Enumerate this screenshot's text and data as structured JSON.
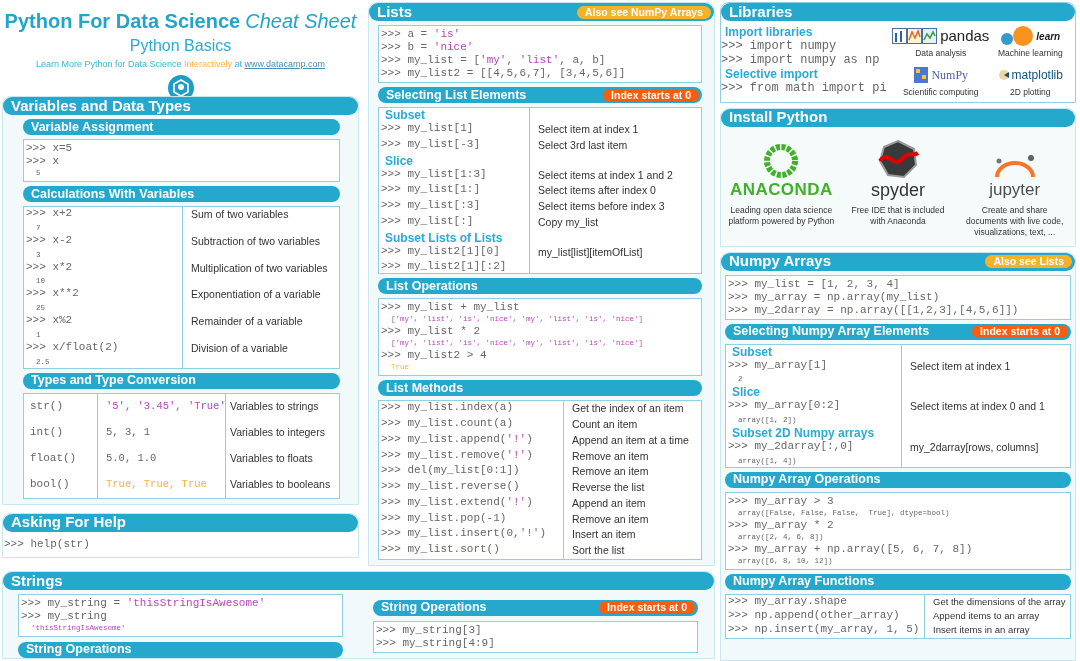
{
  "header": {
    "title": "Python For Data Science",
    "title_italic": "Cheat Sheet",
    "subtitle": "Python Basics",
    "tagline": "Learn More Python for Data Science",
    "tagline_highlight": "Interactively",
    "tagline_after": "at",
    "link": "www.datacamp.com"
  },
  "variables": {
    "title": "Variables and Data Types",
    "assignment": {
      "title": "Variable Assignment",
      "lines": [
        {
          "kind": "code",
          "text": ">>> x=5"
        },
        {
          "kind": "code",
          "text": ">>> x"
        },
        {
          "kind": "output",
          "text": "5"
        }
      ]
    },
    "calculations": {
      "title": "Calculations With Variables",
      "rows": [
        {
          "kind": "code",
          "text": ">>> x+2",
          "note": "Sum of two variables"
        },
        {
          "kind": "output",
          "text": "7"
        },
        {
          "kind": "code",
          "text": ">>> x-2",
          "note": "Subtraction of two variables"
        },
        {
          "kind": "output",
          "text": "3"
        },
        {
          "kind": "code",
          "text": ">>> x*2",
          "note": "Multiplication of two variables"
        },
        {
          "kind": "output",
          "text": "10"
        },
        {
          "kind": "code",
          "text": ">>> x**2",
          "note": "Exponentiation of a variable"
        },
        {
          "kind": "output",
          "text": "25"
        },
        {
          "kind": "code",
          "text": ">>> x%2",
          "note": "Remainder of a variable"
        },
        {
          "kind": "output",
          "text": "1"
        },
        {
          "kind": "code",
          "text": ">>> x/float(2)",
          "note": "Division of a variable"
        },
        {
          "kind": "output",
          "text": "2.5"
        }
      ]
    },
    "types": {
      "title": "Types and Type Conversion",
      "rows": [
        {
          "kind": "string",
          "function": "str()",
          "values": "'5', '3.45', 'True'",
          "note": "Variables to strings"
        },
        {
          "kind": "number",
          "function": "int()",
          "values": "5, 3, 1",
          "note": "Variables to integers"
        },
        {
          "kind": "number",
          "function": "float()",
          "values": "5.0, 1.0",
          "note": "Variables to floats"
        },
        {
          "kind": "boolean",
          "function": "bool()",
          "values": "True, True, True",
          "note": "Variables to booleans"
        }
      ]
    }
  },
  "help": {
    "title": "Asking For Help",
    "lines": [
      {
        "kind": "code",
        "text": ">>> help(str)"
      }
    ]
  },
  "strings": {
    "title": "Strings",
    "intro": {
      "lines": [
        {
          "kind": "code",
          "text": ">>> my_string = 'thisStringIsAwesome'"
        },
        {
          "kind": "code",
          "text": ">>> my_string"
        },
        {
          "kind": "string",
          "text": "'thisStringIsAwesome'"
        }
      ]
    },
    "operations_left": {
      "title": "String Operations"
    },
    "operations": {
      "title": "String Operations",
      "badge": {
        "text": "Index starts at 0",
        "kind": "warning"
      },
      "lines": [
        {
          "kind": "code",
          "text": ">>> my_string[3]"
        },
        {
          "kind": "code",
          "text": ">>> my_string[4:9]"
        }
      ]
    }
  },
  "lists": {
    "title": "Lists",
    "badge": {
      "text": "Also see NumPy Arrays",
      "kind": "note"
    },
    "intro": {
      "lines": [
        {
          "kind": "code",
          "text": ">>> a = 'is'"
        },
        {
          "kind": "code",
          "text": ">>> b = 'nice'"
        },
        {
          "kind": "code",
          "text": ">>> my_list = ['my', 'list', a, b]"
        },
        {
          "kind": "code",
          "text": ">>> my_list2 = [[4,5,6,7], [3,4,5,6]]"
        }
      ]
    },
    "selecting": {
      "title": "Selecting List Elements",
      "badge": {
        "text": "Index starts at 0",
        "kind": "warning"
      },
      "rows": [
        {
          "kind": "label",
          "text": "Subset"
        },
        {
          "kind": "code",
          "text": ">>> my_list[1]",
          "note": "Select item at index 1"
        },
        {
          "kind": "code",
          "text": ">>> my_list[-3]",
          "note": "Select 3rd last item"
        },
        {
          "kind": "label",
          "text": "Slice"
        },
        {
          "kind": "code",
          "text": ">>> my_list[1:3]",
          "note": "Select items at index 1 and 2"
        },
        {
          "kind": "code",
          "text": ">>> my_list[1:]",
          "note": "Select items after index 0"
        },
        {
          "kind": "code",
          "text": ">>> my_list[:3]",
          "note": "Select items before index 3"
        },
        {
          "kind": "code",
          "text": ">>> my_list[:]",
          "note": "Copy my_list"
        },
        {
          "kind": "label",
          "text": "Subset Lists of Lists"
        },
        {
          "kind": "code",
          "text": ">>> my_list2[1][0]",
          "note": "my_list[list][itemOfList]"
        },
        {
          "kind": "code",
          "text": ">>> my_list2[1][:2]"
        }
      ]
    },
    "operations": {
      "title": "List Operations",
      "lines": [
        {
          "kind": "code",
          "text": ">>> my_list + my_list"
        },
        {
          "kind": "string",
          "text": "['my', 'list', 'is', 'nice', 'my', 'list', 'is', 'nice']"
        },
        {
          "kind": "code",
          "text": ">>> my_list * 2"
        },
        {
          "kind": "string",
          "text": "['my', 'list', 'is', 'nice', 'my', 'list', 'is', 'nice']"
        },
        {
          "kind": "code",
          "text": ">>> my_list2 > 4"
        },
        {
          "kind": "boolean",
          "text": "True"
        }
      ]
    },
    "methods": {
      "title": "List Methods",
      "rows": [
        {
          "kind": "code",
          "text": ">>> my_list.index(a)",
          "note": "Get the index of an item"
        },
        {
          "kind": "code",
          "text": ">>> my_list.count(a)",
          "note": "Count an item"
        },
        {
          "kind": "code",
          "text": ">>> my_list.append('!')",
          "note": "Append an item at a time"
        },
        {
          "kind": "code",
          "text": ">>> my_list.remove('!')",
          "note": "Remove an item"
        },
        {
          "kind": "code",
          "text": ">>> del(my_list[0:1])",
          "note": "Remove an item"
        },
        {
          "kind": "code",
          "text": ">>> my_list.reverse()",
          "note": "Reverse the list"
        },
        {
          "kind": "code",
          "text": ">>> my_list.extend('!')",
          "note": "Append an item"
        },
        {
          "kind": "code",
          "text": ">>> my_list.pop(-1)",
          "note": "Remove an item"
        },
        {
          "kind": "code",
          "text": ">>> my_list.insert(0,'!')",
          "note": "Insert an item"
        },
        {
          "kind": "code",
          "text": ">>> my_list.sort()",
          "note": "Sort the list"
        }
      ]
    }
  },
  "libraries": {
    "title": "Libraries",
    "rows": [
      {
        "kind": "label",
        "text": "Import libraries"
      },
      {
        "kind": "code",
        "text": ">>> import numpy"
      },
      {
        "kind": "code",
        "text": ">>> import numpy as np"
      },
      {
        "kind": "label",
        "text": "Selective import"
      },
      {
        "kind": "code",
        "text": ">>> from math import pi"
      }
    ],
    "logos": [
      {
        "kind": "pandas",
        "text": "pandas",
        "caption": "Data analysis"
      },
      {
        "kind": "sklearn",
        "text": "learn",
        "caption": "Machine learning"
      },
      {
        "kind": "numpy",
        "text": "NumPy",
        "caption": "Scientific computing"
      },
      {
        "kind": "matplotlib",
        "text": "matplotlib",
        "caption": "2D plotting"
      }
    ]
  },
  "install": {
    "title": "Install Python",
    "items": [
      {
        "kind": "anaconda",
        "logo_text": "ANACONDA",
        "caption": "Leading open data science platform powered by Python"
      },
      {
        "kind": "spyder",
        "logo_text": "spyder",
        "caption": "Free IDE that is included with Anaconda"
      },
      {
        "kind": "jupyter",
        "logo_text": "jupyter",
        "caption": "Create and share documents with live code, visualizations, text, ..."
      }
    ]
  },
  "numpy": {
    "title": "Numpy Arrays",
    "badge": {
      "text": "Also see Lists",
      "kind": "note"
    },
    "intro": {
      "lines": [
        {
          "kind": "code",
          "text": ">>> my_list = [1, 2, 3, 4]"
        },
        {
          "kind": "code",
          "text": ">>> my_array = np.array(my_list)"
        },
        {
          "kind": "code",
          "text": ">>> my_2darray = np.array([[1,2,3],[4,5,6]])"
        }
      ]
    },
    "selecting": {
      "title": "Selecting Numpy Array Elements",
      "badge": {
        "text": "Index starts at 0",
        "kind": "warning"
      },
      "rows": [
        {
          "kind": "label",
          "text": "Subset"
        },
        {
          "kind": "code",
          "text": ">>> my_array[1]",
          "note": "Select item at index 1"
        },
        {
          "kind": "output",
          "text": "2"
        },
        {
          "kind": "label",
          "text": "Slice"
        },
        {
          "kind": "code",
          "text": ">>> my_array[0:2]",
          "note": "Select items at index 0 and 1"
        },
        {
          "kind": "output",
          "text": "array([1, 2])"
        },
        {
          "kind": "label",
          "text": "Subset 2D Numpy arrays"
        },
        {
          "kind": "code",
          "text": ">>> my_2darray[:,0]",
          "note": "my_2darray[rows, columns]"
        },
        {
          "kind": "output",
          "text": "array([1, 4])"
        }
      ]
    },
    "operations": {
      "title": "Numpy Array Operations",
      "lines": [
        {
          "kind": "code",
          "text": ">>> my_array > 3"
        },
        {
          "kind": "output",
          "text": "array([False, False, False,  True], dtype=bool)"
        },
        {
          "kind": "code",
          "text": ">>> my_array * 2"
        },
        {
          "kind": "output",
          "text": "array([2, 4, 6, 8])"
        },
        {
          "kind": "code",
          "text": ">>> my_array + np.array([5, 6, 7, 8])"
        },
        {
          "kind": "output",
          "text": "array([6, 8, 10, 12])"
        }
      ]
    },
    "functions": {
      "title": "Numpy Array Functions",
      "rows": [
        {
          "kind": "code",
          "text": ">>> my_array.shape",
          "note": "Get the dimensions of the array"
        },
        {
          "kind": "code",
          "text": ">>> np.append(other_array)",
          "note": "Append items to an array"
        },
        {
          "kind": "code",
          "text": ">>> np.insert(my_array, 1, 5)",
          "note": "Insert items in an array"
        }
      ]
    }
  }
}
